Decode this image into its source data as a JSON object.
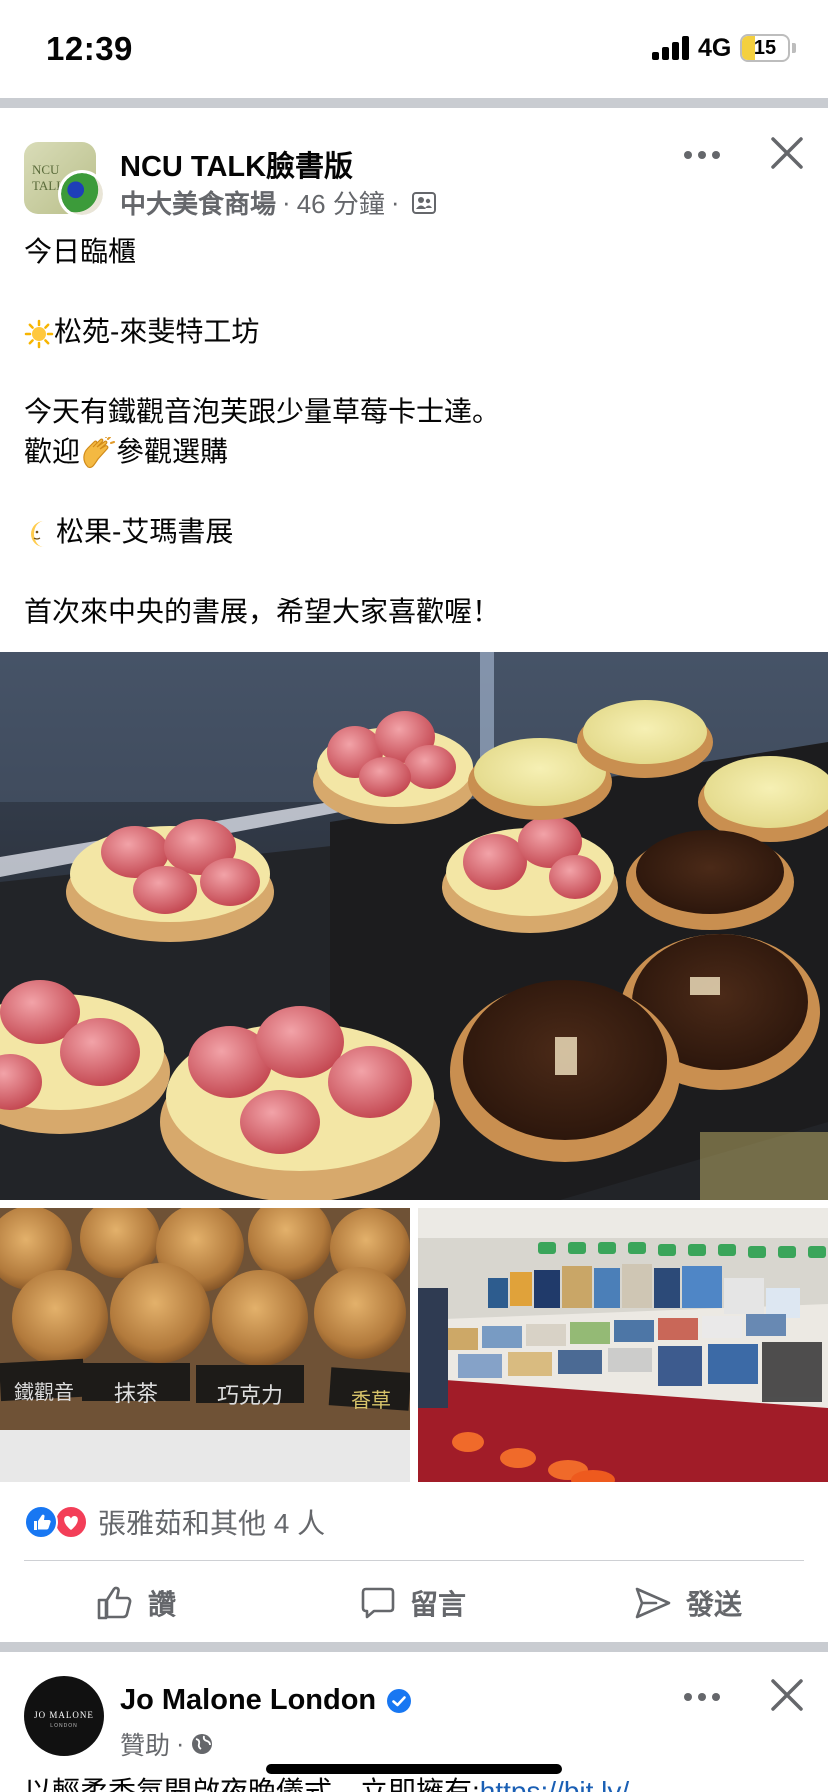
{
  "status_bar": {
    "time": "12:39",
    "network": "4G",
    "battery_level": "15"
  },
  "post": {
    "page_name": "NCU TALK臉書版",
    "group_name": "中大美食商場",
    "dot": "·",
    "time_ago": "46 分鐘",
    "text_lines": [
      "今日臨櫃",
      "",
      "松苑-來斐特工坊",
      "",
      "今天有鐵觀音泡芙跟少量草莓卡士達。",
      "歡迎",
      "參觀選購",
      "",
      "松果-艾瑪書展",
      "",
      "首次來中央的書展，希望大家喜歡喔！"
    ],
    "photo_left_labels": [
      "鐵觀音",
      "抹茶",
      "巧克力",
      "香草"
    ],
    "reactions_text": "張雅茹和其他 4 人",
    "actions": {
      "like": "讚",
      "comment": "留言",
      "send": "發送"
    }
  },
  "post2": {
    "page_name": "Jo Malone London",
    "sponsored": "贊助",
    "dot": "·",
    "avatar_brand": "JO MALONE",
    "avatar_sub": "LONDON",
    "text_start": "以輕柔香氛開啟夜晚儀式，立即擁有:",
    "link": "https://bit.ly/"
  },
  "colors": {
    "facebook_blue": "#1877f2",
    "love_red": "#f33e58",
    "secondary_text": "#65676b",
    "separator": "#c9ccd1"
  },
  "icons": [
    "more-icon",
    "close-icon",
    "group-icon",
    "like-icon",
    "comment-icon",
    "send-icon",
    "globe-icon",
    "verified-icon",
    "sun-emoji",
    "clap-emoji",
    "moon-emoji"
  ]
}
